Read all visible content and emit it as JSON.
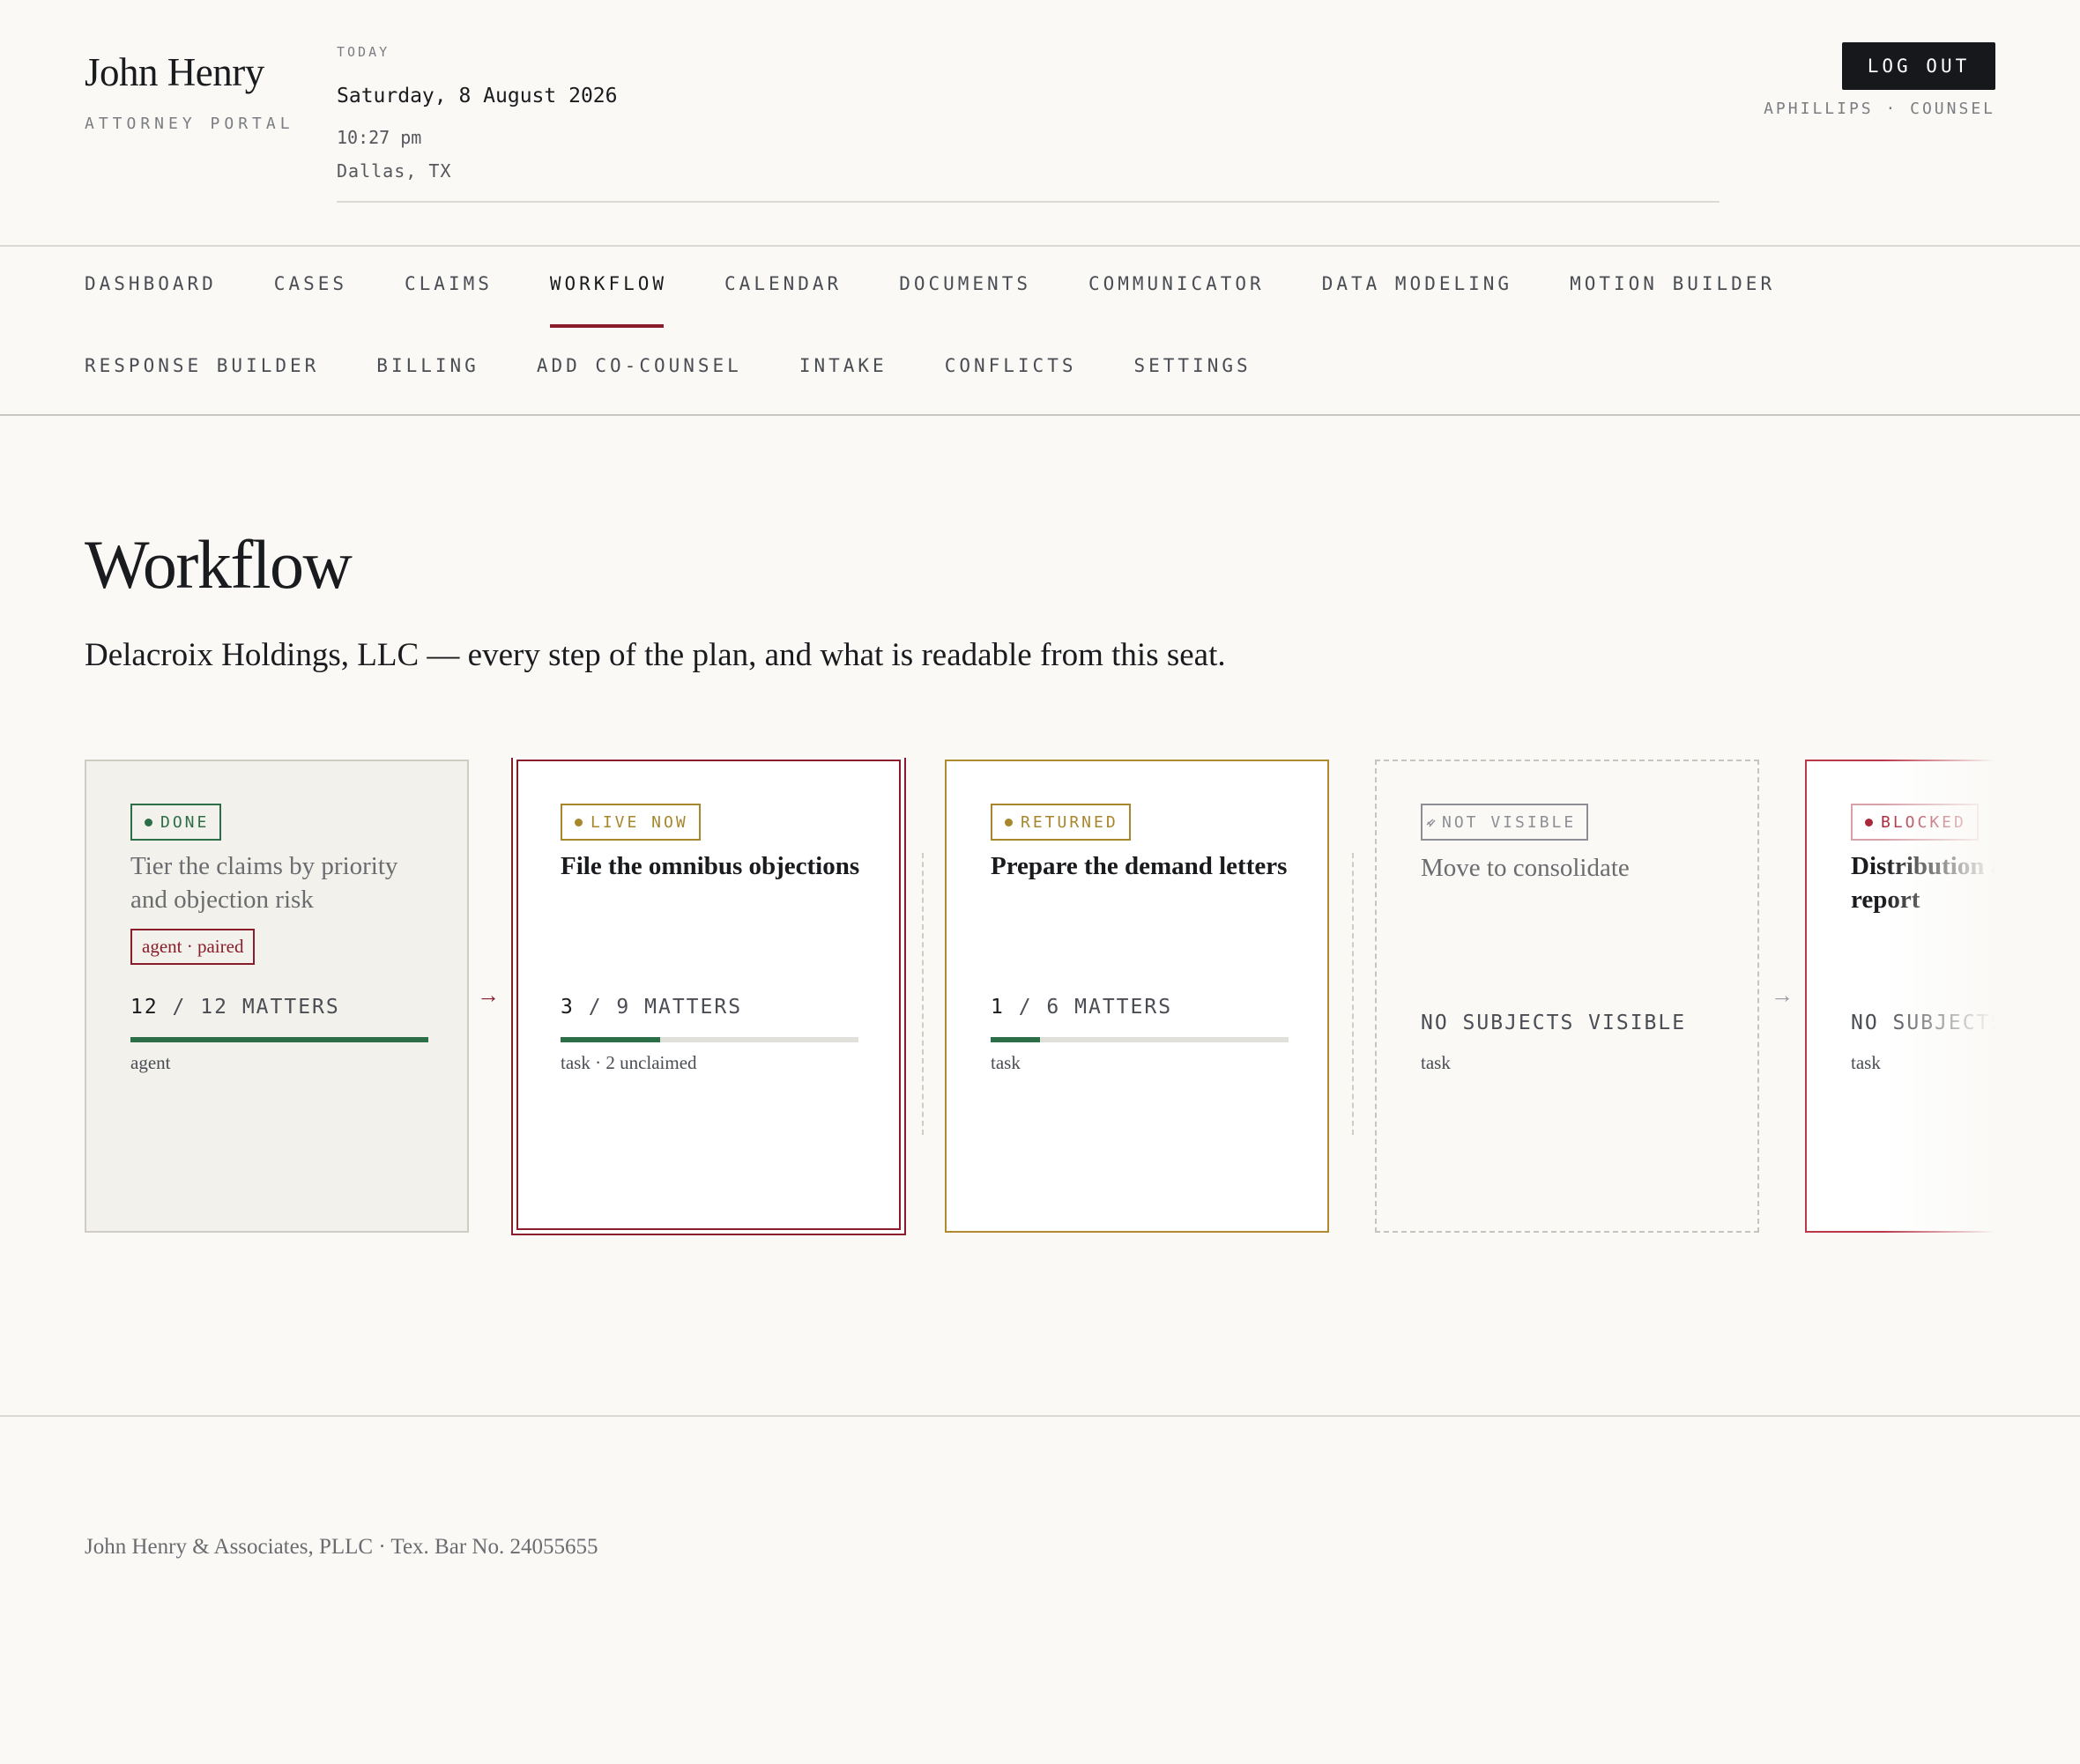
{
  "brand": {
    "name": "John Henry",
    "subtitle": "ATTORNEY PORTAL"
  },
  "today": {
    "label": "TODAY",
    "date": "Saturday, 8 August 2026",
    "time": "10:27 pm",
    "location": "Dallas, TX"
  },
  "account": {
    "logout_label": "LOG OUT",
    "user_line": "APHILLIPS · COUNSEL"
  },
  "nav": {
    "row1": [
      "DASHBOARD",
      "CASES",
      "CLAIMS",
      "WORKFLOW",
      "CALENDAR",
      "DOCUMENTS",
      "COMMUNICATOR",
      "DATA MODELING",
      "MOTION BUILDER"
    ],
    "row2": [
      "RESPONSE BUILDER",
      "BILLING",
      "ADD CO-COUNSEL",
      "INTAKE",
      "CONFLICTS",
      "SETTINGS"
    ],
    "active": "WORKFLOW"
  },
  "page": {
    "title": "Workflow",
    "subtitle": "Delacroix Holdings, LLC — every step of the plan, and what is readable from this seat."
  },
  "steps": [
    {
      "status": "DONE",
      "status_color": "#2c6e47",
      "title": "Tier the claims by priority and objection risk",
      "tag": "agent · paired",
      "done": "12",
      "total": "12",
      "unit": "MATTERS",
      "progress": 1.0,
      "meta": "agent"
    },
    {
      "status": "LIVE NOW",
      "status_color": "#a8862c",
      "title": "File the omnibus objections",
      "done": "3",
      "total": "9",
      "unit": "MATTERS",
      "progress": 0.333,
      "meta": "task · 2 unclaimed"
    },
    {
      "status": "RETURNED",
      "status_color": "#a8862c",
      "title": "Prepare the demand letters",
      "done": "1",
      "total": "6",
      "unit": "MATTERS",
      "progress": 0.167,
      "meta": "task"
    },
    {
      "status": "NOT VISIBLE",
      "status_color": "#8d8f94",
      "title": "Move to consolidate",
      "empty_label": "NO SUBJECTS VISIBLE",
      "meta": "task"
    },
    {
      "status": "BLOCKED",
      "status_color": "#a8283c",
      "title": "Distribution analysis report",
      "empty_label": "NO SUBJECTS VISIBLE",
      "meta": "task"
    }
  ],
  "arrows": {
    "glyph": "→",
    "active_color": "#8a1d2b",
    "muted_color": "#9a9ca0"
  },
  "footer": {
    "text": "John Henry & Associates, PLLC · Tex. Bar No. 24055655"
  },
  "colors": {
    "accent": "#8a1d2b",
    "success": "#2c6e47",
    "warning": "#a8862c",
    "danger": "#a8283c",
    "background": "#faf9f6"
  }
}
